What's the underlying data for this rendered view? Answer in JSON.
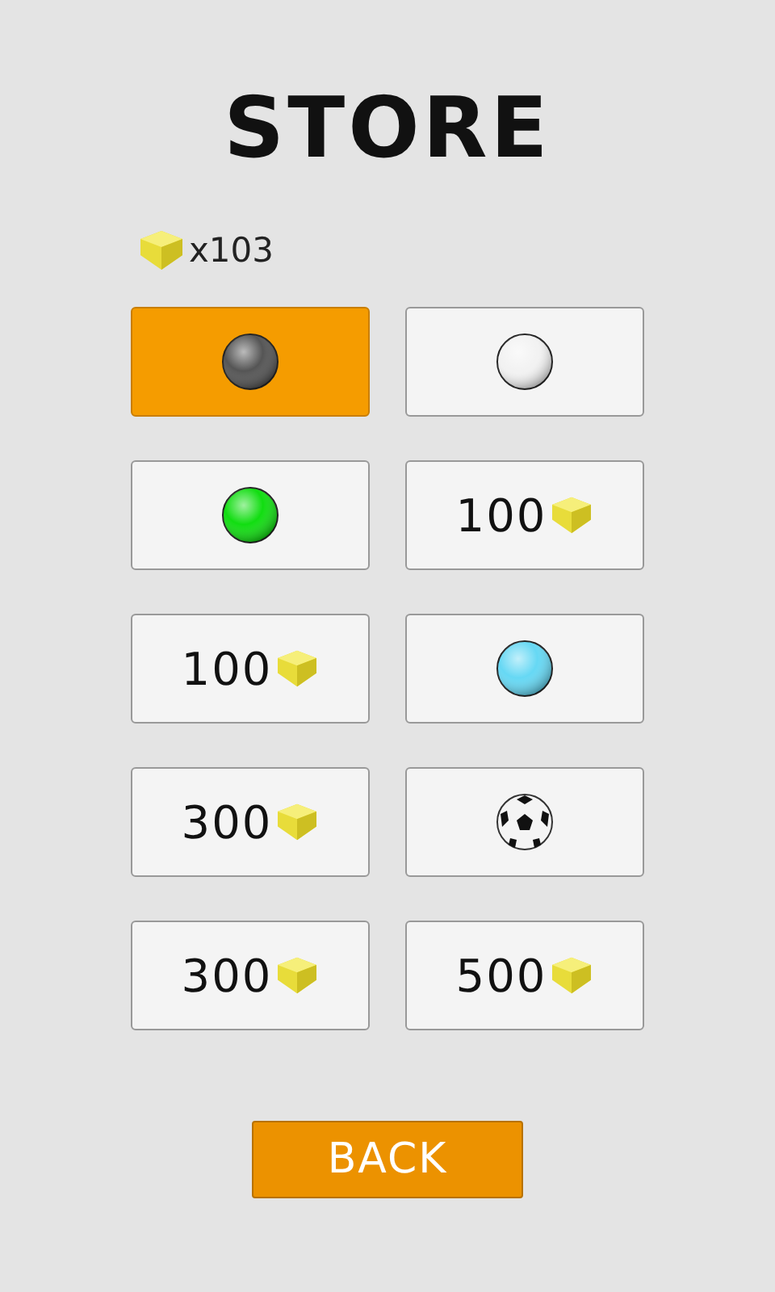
{
  "title": "STORE",
  "coins": "x103",
  "items": [
    {
      "kind": "ball",
      "color": "#555555",
      "selected": true
    },
    {
      "kind": "ball",
      "color": "#f2f2f2",
      "selected": false
    },
    {
      "kind": "ball",
      "color": "#11dd11",
      "selected": false
    },
    {
      "kind": "price",
      "price": "100",
      "selected": false
    },
    {
      "kind": "price",
      "price": "100",
      "selected": false
    },
    {
      "kind": "ball",
      "color": "#66d8f4",
      "selected": false
    },
    {
      "kind": "price",
      "price": "300",
      "selected": false
    },
    {
      "kind": "soccer",
      "selected": false
    },
    {
      "kind": "price",
      "price": "300",
      "selected": false
    },
    {
      "kind": "price",
      "price": "500",
      "selected": false
    }
  ],
  "back_button": "BACK"
}
